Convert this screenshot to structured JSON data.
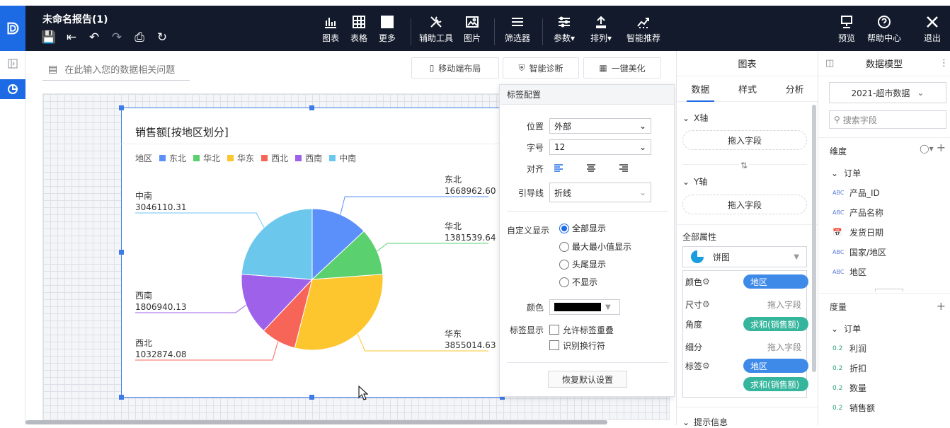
{
  "header": {
    "doc_title": "未命名报告(1)",
    "toolbar": [
      {
        "label": "图表",
        "icon": "bar-chart-icon"
      },
      {
        "label": "表格",
        "icon": "table-icon"
      },
      {
        "label": "更多",
        "icon": "grid-more-icon"
      },
      {
        "label": "辅助工具",
        "icon": "tools-icon"
      },
      {
        "label": "图片",
        "icon": "image-icon"
      },
      {
        "label": "筛选器",
        "icon": "filter-icon"
      },
      {
        "label": "参数",
        "icon": "params-icon"
      },
      {
        "label": "排列",
        "icon": "arrange-icon"
      },
      {
        "label": "智能推荐",
        "icon": "recommend-icon"
      }
    ],
    "right": [
      {
        "label": "预览",
        "icon": "preview-icon"
      },
      {
        "label": "帮助中心",
        "icon": "help-icon"
      },
      {
        "label": "退出",
        "icon": "close-icon"
      }
    ]
  },
  "ask": {
    "placeholder": "在此输入您的数据相关问题"
  },
  "top_buttons": {
    "mobile": "移动端布局",
    "diagnose": "智能诊断",
    "beautify": "一键美化"
  },
  "chart_data": {
    "type": "pie",
    "title": "销售额[按地区划分]",
    "legend_title": "地区",
    "legend_position": "top-left",
    "slices": [
      {
        "name": "东北",
        "value": 1668962.6,
        "label": "1668962.60",
        "color": "#5b8ff9"
      },
      {
        "name": "华北",
        "value": 1381539.64,
        "label": "1381539.64",
        "color": "#5ad06e"
      },
      {
        "name": "华东",
        "value": 3855014.63,
        "label": "3855014.63",
        "color": "#fec62e"
      },
      {
        "name": "西北",
        "value": 1032874.08,
        "label": "1032874.08",
        "color": "#f76559"
      },
      {
        "name": "西南",
        "value": 1806940.13,
        "label": "1806940.13",
        "color": "#9e61ea"
      },
      {
        "name": "中南",
        "value": 3046110.31,
        "label": "3046110.31",
        "color": "#6cc7ec"
      }
    ]
  },
  "popup": {
    "title": "标签配置",
    "position_label": "位置",
    "position_value": "外部",
    "fontsize_label": "字号",
    "fontsize_value": "12",
    "align_label": "对齐",
    "guide_label": "引导线",
    "guide_value": "折线",
    "custom_label": "自定义显示",
    "radio": [
      "全部显示",
      "最大最小值显示",
      "头尾显示",
      "不显示"
    ],
    "radio_selected": 0,
    "color_label": "颜色",
    "color_value": "#000000",
    "label_display": "标签显示",
    "overlap": "允许标签重叠",
    "wrap": "识别换行符",
    "restore": "恢复默认设置"
  },
  "chart_panel": {
    "header": "图表",
    "tabs": [
      "数据",
      "样式",
      "分析"
    ],
    "active_tab": 0,
    "x_axis": "X轴",
    "y_axis": "Y轴",
    "drop": "拖入字段",
    "swap": "⇅",
    "all_attr": "全部属性",
    "chart_type": "饼图",
    "rows": [
      {
        "label": "颜色",
        "pill": "地区",
        "pill_color": "blue",
        "gear": true
      },
      {
        "label": "尺寸",
        "hint": "拖入字段",
        "gear": true
      },
      {
        "label": "角度",
        "pill": "求和(销售额)",
        "pill_color": "green"
      },
      {
        "label": "细分",
        "hint": "拖入字段"
      },
      {
        "label": "标签",
        "pill": "地区",
        "pill_color": "blue",
        "gear": true
      },
      {
        "label": "",
        "pill": "求和(销售额)",
        "pill_color": "green"
      }
    ],
    "tooltip": "提示信息"
  },
  "model_panel": {
    "header": "数据模型",
    "dataset": "2021-超市数据",
    "search_placeholder": "搜索字段",
    "dimension": "维度",
    "dim_group": "订单",
    "dim_fields": [
      {
        "name": "产品_ID",
        "type": "ABC"
      },
      {
        "name": "产品名称",
        "type": "ABC"
      },
      {
        "name": "发货日期",
        "type": "date"
      },
      {
        "name": "国家/地区",
        "type": "ABC"
      },
      {
        "name": "地区",
        "type": "ABC"
      }
    ],
    "measure": "度量",
    "measure_group": "订单",
    "measure_fields": [
      {
        "name": "利润",
        "type": "0.2"
      },
      {
        "name": "折扣",
        "type": "0.2"
      },
      {
        "name": "数量",
        "type": "0.2"
      },
      {
        "name": "销售额",
        "type": "0.2"
      }
    ]
  }
}
